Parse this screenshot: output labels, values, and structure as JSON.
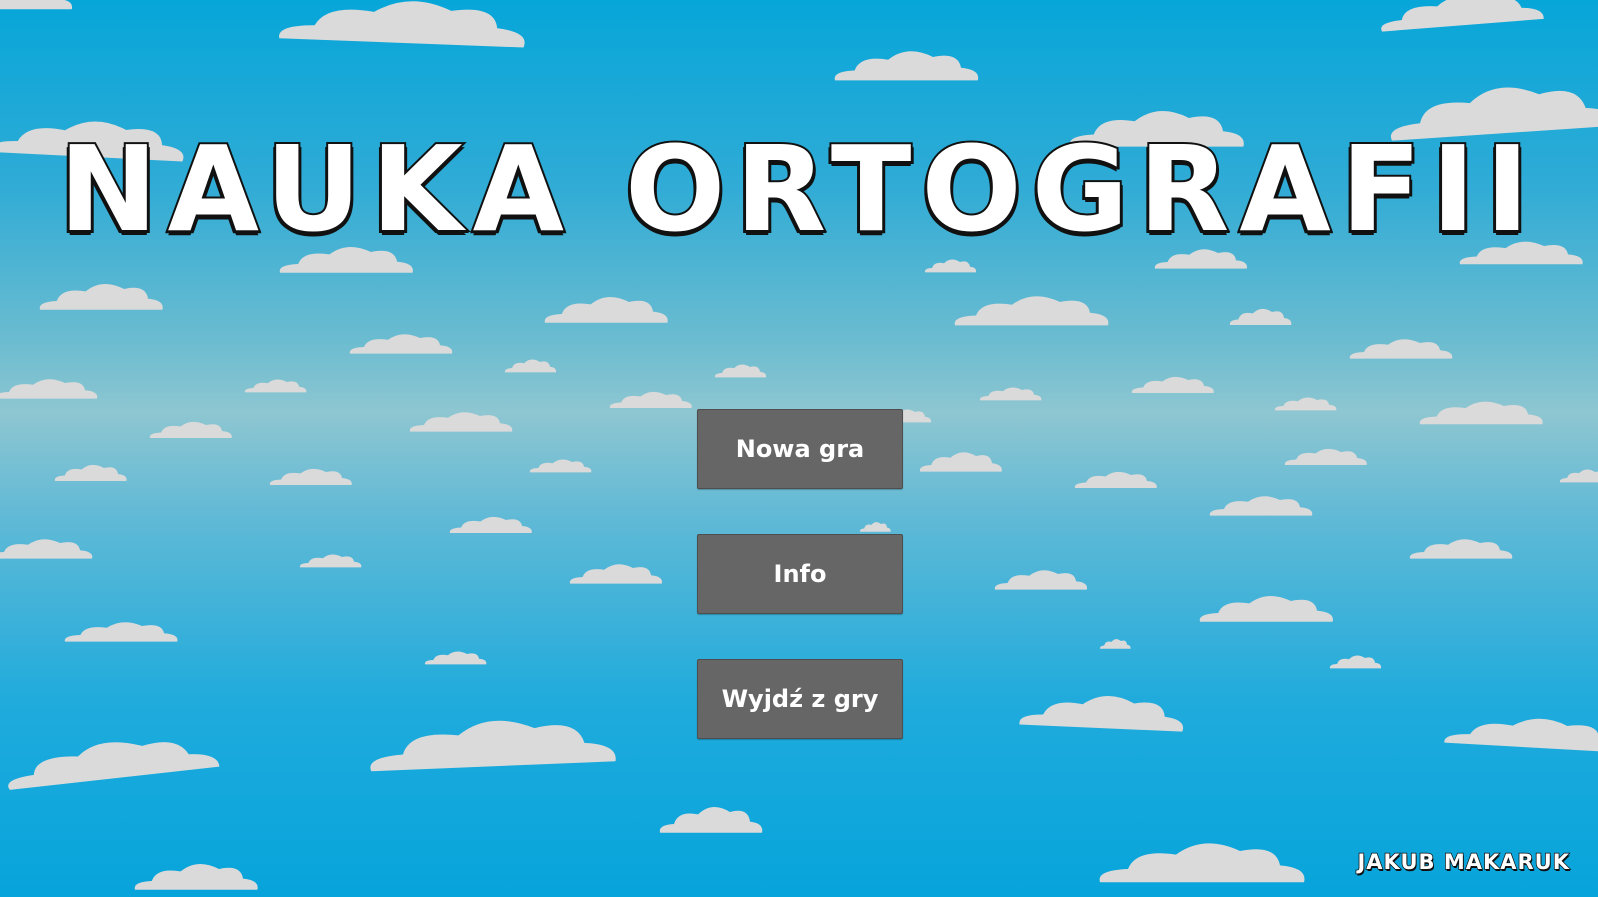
{
  "game": {
    "title": "NAUKA ORTOGRAFII",
    "author": "JAKUB MAKARUK"
  },
  "menu": {
    "new_game_label": "Nowa gra",
    "info_label": "Info",
    "exit_label": "Wyjdź z gry"
  },
  "theme": {
    "sky_color": "#06a6d9",
    "cloud_color": "#d9d9d9",
    "button_color": "#666666",
    "button_text_color": "#ffffff",
    "title_outline_color": "#111111"
  }
}
